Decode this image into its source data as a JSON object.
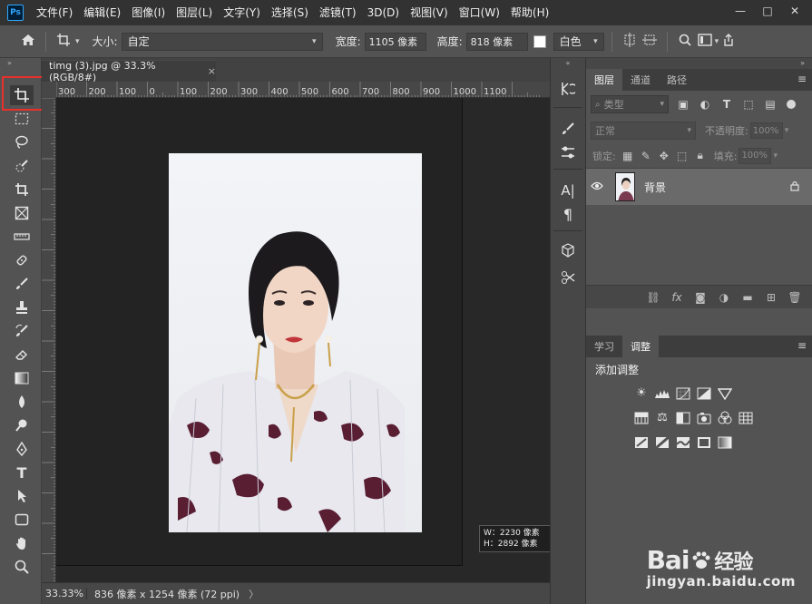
{
  "app": {
    "logo_text": "Ps",
    "menu": [
      "文件(F)",
      "编辑(E)",
      "图像(I)",
      "图层(L)",
      "文字(Y)",
      "选择(S)",
      "滤镜(T)",
      "3D(D)",
      "视图(V)",
      "窗口(W)",
      "帮助(H)"
    ],
    "window_controls": [
      "—",
      "□",
      "✕"
    ]
  },
  "options": {
    "size_label": "大小:",
    "size_value": "自定",
    "width_label": "宽度:",
    "width_value": "1105 像素",
    "height_label": "高度:",
    "height_value": "818 像素",
    "bg_value": "白色"
  },
  "document": {
    "tab_title": "timg (3).jpg @ 33.3%(RGB/8#)",
    "tab_close": "×",
    "ruler_top_labels": [
      "300",
      "200",
      "100",
      "0",
      "100",
      "200",
      "300",
      "400",
      "500",
      "600",
      "700",
      "800",
      "900",
      "1000",
      "1100"
    ],
    "size_tooltip_w": "W：2230 像素",
    "size_tooltip_h": "H：2892 像素"
  },
  "status": {
    "zoom": "33.33%",
    "info": "836 像素 x 1254 像素 (72 ppi)",
    "arrow": "〉"
  },
  "layers_panel": {
    "tabs": [
      "图层",
      "通道",
      "路径"
    ],
    "filter_label": "类型",
    "blend_mode": "正常",
    "opacity_label": "不透明度:",
    "opacity_value": "100%",
    "lock_label": "锁定:",
    "fill_label": "填充:",
    "fill_value": "100%",
    "layer_name": "背景"
  },
  "adjust_panel": {
    "tabs": [
      "学习",
      "调整"
    ],
    "title": "添加调整"
  },
  "watermark": {
    "brand": "Bai",
    "brand_suffix": "经验",
    "url": "jingyan.baidu.com"
  },
  "colors": {
    "accent_highlight": "#e8302b",
    "ps_blue": "#31a8ff"
  }
}
